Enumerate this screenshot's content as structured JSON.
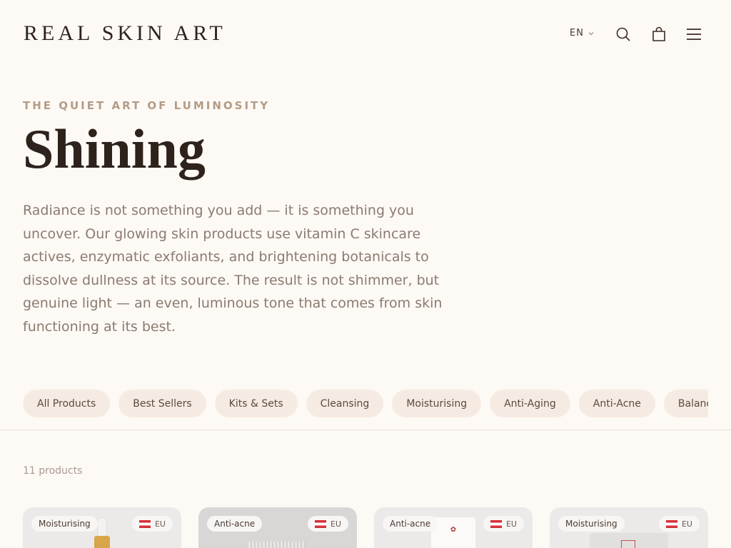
{
  "header": {
    "logo": "REAL SKIN ART",
    "language": "EN",
    "icons": [
      "search-icon",
      "bag-icon",
      "menu-icon"
    ]
  },
  "hero": {
    "eyebrow": "THE QUIET ART OF LUMINOSITY",
    "title": "Shining",
    "description": "Radiance is not something you add — it is something you uncover. Our glowing skin products use vitamin C skincare actives, enzymatic exfoliants, and brightening botanicals to dissolve dullness at its source. The result is not shimmer, but genuine light — an even, luminous tone that comes from skin functioning at its best."
  },
  "filters": [
    "All Products",
    "Best Sellers",
    "Kits & Sets",
    "Cleansing",
    "Moisturising",
    "Anti-Aging",
    "Anti-Acne",
    "Balancing"
  ],
  "listing": {
    "count_label": "11 products"
  },
  "products": [
    {
      "category": "Moisturising",
      "region": "EU"
    },
    {
      "category": "Anti-acne",
      "region": "EU"
    },
    {
      "category": "Anti-acne",
      "region": "EU"
    },
    {
      "category": "Moisturising",
      "region": "EU"
    }
  ],
  "colors": {
    "background": "#fdf9f5",
    "chip": "#f6ebe2",
    "accent_text": "#b49c85",
    "body_text": "#8b7a70",
    "heading": "#2e221c"
  }
}
